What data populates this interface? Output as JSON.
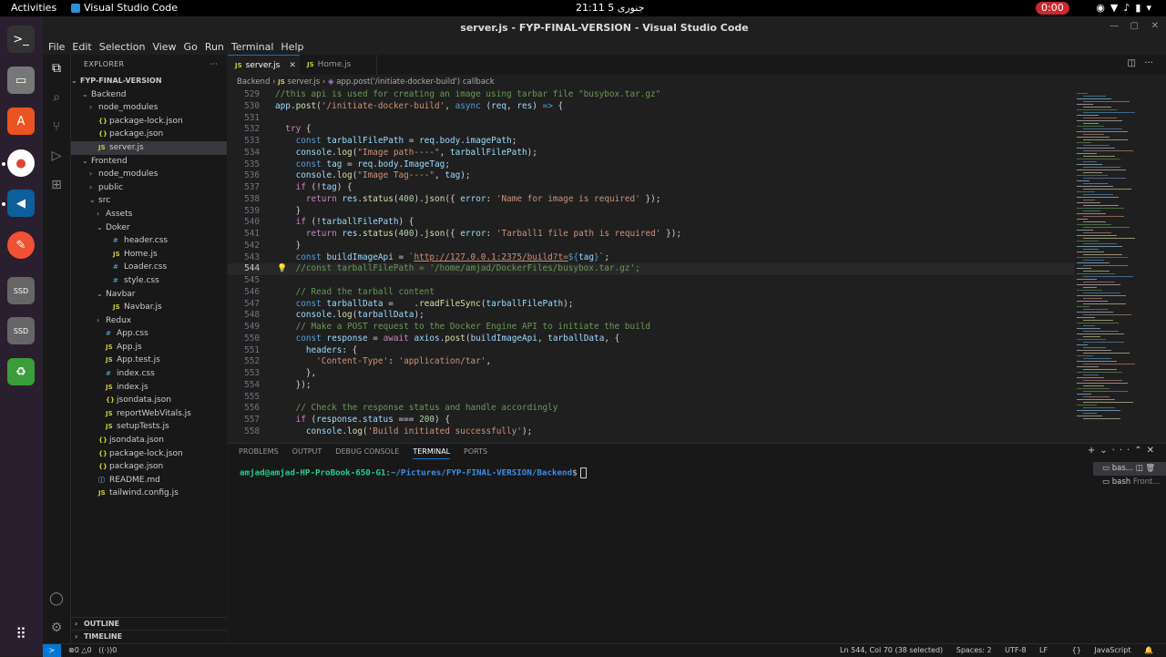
{
  "system": {
    "activities": "Activities",
    "app_name": "Visual Studio Code",
    "clock": "21:11  5 جنوری",
    "recording": "0:00"
  },
  "window": {
    "title": "server.js - FYP-FINAL-VERSION - Visual Studio Code"
  },
  "menu": [
    "File",
    "Edit",
    "Selection",
    "View",
    "Go",
    "Run",
    "Terminal",
    "Help"
  ],
  "explorer": {
    "header": "EXPLORER",
    "more": "···",
    "root": "FYP-FINAL-VERSION",
    "items": [
      {
        "label": "Backend",
        "type": "folder-open",
        "depth": 1
      },
      {
        "label": "node_modules",
        "type": "folder",
        "depth": 2
      },
      {
        "label": "package-lock.json",
        "type": "json",
        "depth": 2
      },
      {
        "label": "package.json",
        "type": "json",
        "depth": 2
      },
      {
        "label": "server.js",
        "type": "js",
        "depth": 2,
        "selected": true
      },
      {
        "label": "Frontend",
        "type": "folder-open",
        "depth": 1
      },
      {
        "label": "node_modules",
        "type": "folder",
        "depth": 2
      },
      {
        "label": "public",
        "type": "folder",
        "depth": 2
      },
      {
        "label": "src",
        "type": "folder-open",
        "depth": 2
      },
      {
        "label": "Assets",
        "type": "folder",
        "depth": 3
      },
      {
        "label": "Doker",
        "type": "folder-open",
        "depth": 3
      },
      {
        "label": "header.css",
        "type": "css",
        "depth": 4
      },
      {
        "label": "Home.js",
        "type": "js",
        "depth": 4
      },
      {
        "label": "Loader.css",
        "type": "css",
        "depth": 4
      },
      {
        "label": "style.css",
        "type": "css",
        "depth": 4
      },
      {
        "label": "Navbar",
        "type": "folder-open",
        "depth": 3
      },
      {
        "label": "Navbar.js",
        "type": "js",
        "depth": 4
      },
      {
        "label": "Redux",
        "type": "folder",
        "depth": 3
      },
      {
        "label": "App.css",
        "type": "css",
        "depth": 3
      },
      {
        "label": "App.js",
        "type": "js",
        "depth": 3
      },
      {
        "label": "App.test.js",
        "type": "js",
        "depth": 3
      },
      {
        "label": "index.css",
        "type": "css",
        "depth": 3
      },
      {
        "label": "index.js",
        "type": "js",
        "depth": 3
      },
      {
        "label": "jsondata.json",
        "type": "json",
        "depth": 3
      },
      {
        "label": "reportWebVitals.js",
        "type": "js",
        "depth": 3
      },
      {
        "label": "setupTests.js",
        "type": "js",
        "depth": 3
      },
      {
        "label": "jsondata.json",
        "type": "json",
        "depth": 2
      },
      {
        "label": "package-lock.json",
        "type": "json",
        "depth": 2
      },
      {
        "label": "package.json",
        "type": "json",
        "depth": 2
      },
      {
        "label": "README.md",
        "type": "md",
        "depth": 2
      },
      {
        "label": "tailwind.config.js",
        "type": "js",
        "depth": 2
      }
    ],
    "outline": "OUTLINE",
    "timeline": "TIMELINE"
  },
  "tabs": [
    {
      "label": "server.js",
      "active": true
    },
    {
      "label": "Home.js",
      "active": false
    }
  ],
  "breadcrumb": {
    "folder": "Backend",
    "file": "server.js",
    "symbol": "app.post('/initiate-docker-build') callback"
  },
  "code": {
    "cursor_line": 544,
    "lines": [
      {
        "n": 529,
        "t": [
          [
            "c-cm",
            "//this api is used for creating an image using tarbar file \"busybox.tar.gz\""
          ]
        ]
      },
      {
        "n": 530,
        "t": [
          [
            "c-var",
            "app"
          ],
          [
            "c-def",
            "."
          ],
          [
            "c-fn",
            "post"
          ],
          [
            "c-def",
            "("
          ],
          [
            "c-str",
            "'/initiate-docker-build'"
          ],
          [
            "c-def",
            ", "
          ],
          [
            "c-kw",
            "async"
          ],
          [
            "c-def",
            " ("
          ],
          [
            "c-var",
            "req"
          ],
          [
            "c-def",
            ", "
          ],
          [
            "c-var",
            "res"
          ],
          [
            "c-def",
            ") "
          ],
          [
            "c-kw",
            "=>"
          ],
          [
            "c-def",
            " {"
          ]
        ]
      },
      {
        "n": 531,
        "t": []
      },
      {
        "n": 532,
        "t": [
          [
            "c-def",
            "  "
          ],
          [
            "c-ctl",
            "try"
          ],
          [
            "c-def",
            " {"
          ]
        ]
      },
      {
        "n": 533,
        "t": [
          [
            "c-def",
            "    "
          ],
          [
            "c-kw",
            "const"
          ],
          [
            "c-def",
            " "
          ],
          [
            "c-var",
            "tarballFilePath"
          ],
          [
            "c-def",
            " = "
          ],
          [
            "c-var",
            "req"
          ],
          [
            "c-def",
            "."
          ],
          [
            "c-var",
            "body"
          ],
          [
            "c-def",
            "."
          ],
          [
            "c-var",
            "imagePath"
          ],
          [
            "c-def",
            ";"
          ]
        ]
      },
      {
        "n": 534,
        "t": [
          [
            "c-def",
            "    "
          ],
          [
            "c-var",
            "console"
          ],
          [
            "c-def",
            "."
          ],
          [
            "c-fn",
            "log"
          ],
          [
            "c-def",
            "("
          ],
          [
            "c-str",
            "\"Image path----\""
          ],
          [
            "c-def",
            ", "
          ],
          [
            "c-var",
            "tarballFilePath"
          ],
          [
            "c-def",
            ");"
          ]
        ]
      },
      {
        "n": 535,
        "t": [
          [
            "c-def",
            "    "
          ],
          [
            "c-kw",
            "const"
          ],
          [
            "c-def",
            " "
          ],
          [
            "c-var",
            "tag"
          ],
          [
            "c-def",
            " = "
          ],
          [
            "c-var",
            "req"
          ],
          [
            "c-def",
            "."
          ],
          [
            "c-var",
            "body"
          ],
          [
            "c-def",
            "."
          ],
          [
            "c-var",
            "ImageTag"
          ],
          [
            "c-def",
            ";"
          ]
        ]
      },
      {
        "n": 536,
        "t": [
          [
            "c-def",
            "    "
          ],
          [
            "c-var",
            "console"
          ],
          [
            "c-def",
            "."
          ],
          [
            "c-fn",
            "log"
          ],
          [
            "c-def",
            "("
          ],
          [
            "c-str",
            "\"Image Tag----\""
          ],
          [
            "c-def",
            ", "
          ],
          [
            "c-var",
            "tag"
          ],
          [
            "c-def",
            ");"
          ]
        ]
      },
      {
        "n": 537,
        "t": [
          [
            "c-def",
            "    "
          ],
          [
            "c-ctl",
            "if"
          ],
          [
            "c-def",
            " (!"
          ],
          [
            "c-var",
            "tag"
          ],
          [
            "c-def",
            ") {"
          ]
        ]
      },
      {
        "n": 538,
        "t": [
          [
            "c-def",
            "      "
          ],
          [
            "c-ctl",
            "return"
          ],
          [
            "c-def",
            " "
          ],
          [
            "c-var",
            "res"
          ],
          [
            "c-def",
            "."
          ],
          [
            "c-fn",
            "status"
          ],
          [
            "c-def",
            "("
          ],
          [
            "c-num",
            "400"
          ],
          [
            "c-def",
            ")."
          ],
          [
            "c-fn",
            "json"
          ],
          [
            "c-def",
            "({ "
          ],
          [
            "c-var",
            "error"
          ],
          [
            "c-def",
            ": "
          ],
          [
            "c-str",
            "'Name for image is required'"
          ],
          [
            "c-def",
            " });"
          ]
        ]
      },
      {
        "n": 539,
        "t": [
          [
            "c-def",
            "    }"
          ]
        ]
      },
      {
        "n": 540,
        "t": [
          [
            "c-def",
            "    "
          ],
          [
            "c-ctl",
            "if"
          ],
          [
            "c-def",
            " (!"
          ],
          [
            "c-var",
            "tarballFilePath"
          ],
          [
            "c-def",
            ") {"
          ]
        ]
      },
      {
        "n": 541,
        "t": [
          [
            "c-def",
            "      "
          ],
          [
            "c-ctl",
            "return"
          ],
          [
            "c-def",
            " "
          ],
          [
            "c-var",
            "res"
          ],
          [
            "c-def",
            "."
          ],
          [
            "c-fn",
            "status"
          ],
          [
            "c-def",
            "("
          ],
          [
            "c-num",
            "400"
          ],
          [
            "c-def",
            ")."
          ],
          [
            "c-fn",
            "json"
          ],
          [
            "c-def",
            "({ "
          ],
          [
            "c-var",
            "error"
          ],
          [
            "c-def",
            ": "
          ],
          [
            "c-str",
            "'Tarball1 file path is required'"
          ],
          [
            "c-def",
            " });"
          ]
        ]
      },
      {
        "n": 542,
        "t": [
          [
            "c-def",
            "    }"
          ]
        ]
      },
      {
        "n": 543,
        "t": [
          [
            "c-def",
            "    "
          ],
          [
            "c-kw",
            "const"
          ],
          [
            "c-def",
            " "
          ],
          [
            "c-var",
            "buildImageApi"
          ],
          [
            "c-def",
            " = "
          ],
          [
            "c-str",
            "`"
          ],
          [
            "c-url",
            "http://127.0.0.1:2375/build?t="
          ],
          [
            "c-kw",
            "${"
          ],
          [
            "c-var",
            "tag"
          ],
          [
            "c-kw",
            "}"
          ],
          [
            "c-str",
            "`"
          ],
          [
            "c-def",
            ";"
          ]
        ]
      },
      {
        "n": 544,
        "t": [
          [
            "c-def",
            "    "
          ],
          [
            "c-cm",
            "//const tarballFilePath = '/home/amjad/DockerFiles/busybox.tar.gz';"
          ]
        ]
      },
      {
        "n": 545,
        "t": []
      },
      {
        "n": 546,
        "t": [
          [
            "c-def",
            "    "
          ],
          [
            "c-cm",
            "// Read the tarball content"
          ]
        ]
      },
      {
        "n": 547,
        "t": [
          [
            "c-def",
            "    "
          ],
          [
            "c-kw",
            "const"
          ],
          [
            "c-def",
            " "
          ],
          [
            "c-var",
            "tarballData"
          ],
          [
            "c-def",
            " =    ."
          ],
          [
            "c-fn",
            "readFileSync"
          ],
          [
            "c-def",
            "("
          ],
          [
            "c-var",
            "tarballFilePath"
          ],
          [
            "c-def",
            ");"
          ]
        ]
      },
      {
        "n": 548,
        "t": [
          [
            "c-def",
            "    "
          ],
          [
            "c-var",
            "console"
          ],
          [
            "c-def",
            "."
          ],
          [
            "c-fn",
            "log"
          ],
          [
            "c-def",
            "("
          ],
          [
            "c-var",
            "tarballData"
          ],
          [
            "c-def",
            ");"
          ]
        ]
      },
      {
        "n": 549,
        "t": [
          [
            "c-def",
            "    "
          ],
          [
            "c-cm",
            "// Make a POST request to the Docker Engine API to initiate the build"
          ]
        ]
      },
      {
        "n": 550,
        "t": [
          [
            "c-def",
            "    "
          ],
          [
            "c-kw",
            "const"
          ],
          [
            "c-def",
            " "
          ],
          [
            "c-var",
            "response"
          ],
          [
            "c-def",
            " = "
          ],
          [
            "c-ctl",
            "await"
          ],
          [
            "c-def",
            " "
          ],
          [
            "c-var",
            "axios"
          ],
          [
            "c-def",
            "."
          ],
          [
            "c-fn",
            "post"
          ],
          [
            "c-def",
            "("
          ],
          [
            "c-var",
            "buildImageApi"
          ],
          [
            "c-def",
            ", "
          ],
          [
            "c-var",
            "tarballData"
          ],
          [
            "c-def",
            ", {"
          ]
        ]
      },
      {
        "n": 551,
        "t": [
          [
            "c-def",
            "      "
          ],
          [
            "c-var",
            "headers"
          ],
          [
            "c-def",
            ": {"
          ]
        ]
      },
      {
        "n": 552,
        "t": [
          [
            "c-def",
            "        "
          ],
          [
            "c-str",
            "'Content-Type'"
          ],
          [
            "c-def",
            ": "
          ],
          [
            "c-str",
            "'application/tar'"
          ],
          [
            "c-def",
            ","
          ]
        ]
      },
      {
        "n": 553,
        "t": [
          [
            "c-def",
            "      },"
          ]
        ]
      },
      {
        "n": 554,
        "t": [
          [
            "c-def",
            "    });"
          ]
        ]
      },
      {
        "n": 555,
        "t": []
      },
      {
        "n": 556,
        "t": [
          [
            "c-def",
            "    "
          ],
          [
            "c-cm",
            "// Check the response status and handle accordingly"
          ]
        ]
      },
      {
        "n": 557,
        "t": [
          [
            "c-def",
            "    "
          ],
          [
            "c-ctl",
            "if"
          ],
          [
            "c-def",
            " ("
          ],
          [
            "c-var",
            "response"
          ],
          [
            "c-def",
            "."
          ],
          [
            "c-var",
            "status"
          ],
          [
            "c-def",
            " === "
          ],
          [
            "c-num",
            "200"
          ],
          [
            "c-def",
            ") {"
          ]
        ]
      },
      {
        "n": 558,
        "t": [
          [
            "c-def",
            "      "
          ],
          [
            "c-var",
            "console"
          ],
          [
            "c-def",
            "."
          ],
          [
            "c-fn",
            "log"
          ],
          [
            "c-def",
            "("
          ],
          [
            "c-str",
            "'Build initiated successfully'"
          ],
          [
            "c-def",
            ");"
          ]
        ]
      }
    ]
  },
  "panel": {
    "tabs": [
      "PROBLEMS",
      "OUTPUT",
      "DEBUG CONSOLE",
      "TERMINAL",
      "PORTS"
    ],
    "active_tab": "TERMINAL",
    "prompt_user": "amjad@amjad-HP-ProBook-650-G1",
    "prompt_path": "~/Pictures/FYP-FINAL-VERSION/Backend",
    "prompt_symbol": "$",
    "terminals": [
      {
        "label": "bas...",
        "selected": true
      },
      {
        "label": "bash",
        "sub": "Front...",
        "selected": false
      }
    ]
  },
  "status": {
    "errors": "0",
    "warnings": "0",
    "ports": "0",
    "position": "Ln 544, Col 70 (38 selected)",
    "spaces": "Spaces: 2",
    "encoding": "UTF-8",
    "eol": "LF",
    "language": "JavaScript"
  },
  "colors": {
    "accent": "#0078d4",
    "editor_bg": "#1f1f1f",
    "sidebar_bg": "#181818"
  }
}
